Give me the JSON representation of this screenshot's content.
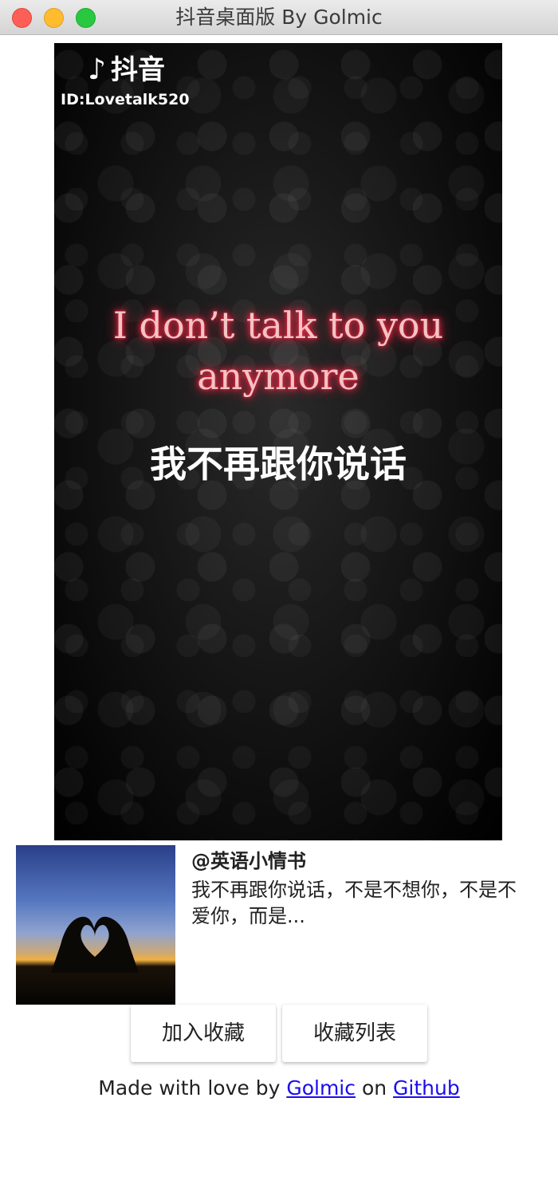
{
  "window": {
    "title": "抖音桌面版 By Golmic"
  },
  "video": {
    "brand_note": "♪",
    "brand_text": "抖音",
    "id_text": "ID:Lovetalk520",
    "caption_en_line1": "I don’t talk to you",
    "caption_en_line2": "anymore",
    "caption_zh": "我不再跟你说话"
  },
  "info": {
    "author": "@英语小情书",
    "description": "我不再跟你说话，不是不想你，不是不爱你，而是..."
  },
  "buttons": {
    "add_favorite": "加入收藏",
    "favorite_list": "收藏列表"
  },
  "footer": {
    "prefix": "Made with love by",
    "author_link": "Golmic",
    "middle": "on",
    "github_link": "Github"
  },
  "colors": {
    "close": "#fd5f57",
    "minimize": "#febc2e",
    "maximize": "#28c840",
    "link": "#1a0dee",
    "caption_glow": "#ff2a4a"
  }
}
